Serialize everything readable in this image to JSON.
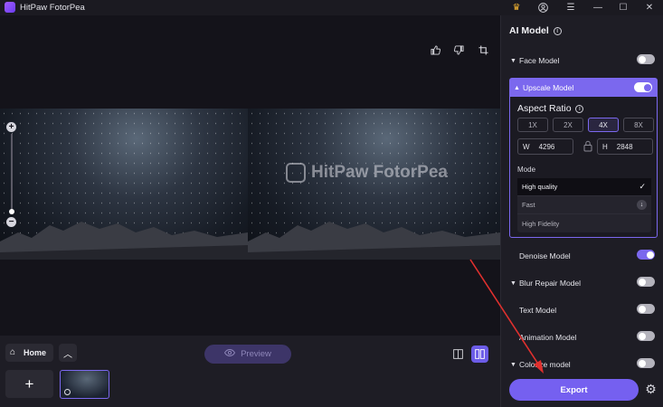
{
  "window": {
    "title": "HitPaw FotorPea",
    "controls": [
      "crown-icon",
      "account-icon",
      "menu-icon",
      "minimize-icon",
      "maximize-icon",
      "close-icon"
    ]
  },
  "canvas": {
    "tools": [
      "thumbs-up-icon",
      "thumbs-down-icon",
      "crop-icon"
    ],
    "watermark": "HitPaw FotorPea",
    "zoom_in": "+",
    "zoom_out": "−"
  },
  "bottom": {
    "home_label": "Home",
    "preview_label": "Preview",
    "add_symbol": "+"
  },
  "panel": {
    "title": "AI Model",
    "face_model": "Face Model",
    "upscale_model": "Upscale Model",
    "aspect_ratio_title": "Aspect Ratio",
    "ratios": [
      "1X",
      "2X",
      "4X",
      "8X"
    ],
    "active_ratio": "4X",
    "width_label": "W",
    "width_value": "4296",
    "height_label": "H",
    "height_value": "2848",
    "mode_label": "Mode",
    "modes": [
      "High quality",
      "Fast",
      "High Fidelity"
    ],
    "selected_mode": "High quality",
    "denoise_model": "Denoise Model",
    "blur_repair_model": "Blur Repair Model",
    "text_model": "Text Model",
    "animation_model": "Animation Model",
    "colorize_model": "Colorize model",
    "export_label": "Export"
  },
  "toggles": {
    "face_model": false,
    "upscale_model": true,
    "denoise_model": true,
    "blur_repair_model": false,
    "text_model": false,
    "animation_model": false,
    "colorize_model": false
  },
  "colors": {
    "accent": "#7b68ee",
    "background": "#17161d",
    "panel": "#1e1d25",
    "annotation_arrow": "#e0302e"
  }
}
